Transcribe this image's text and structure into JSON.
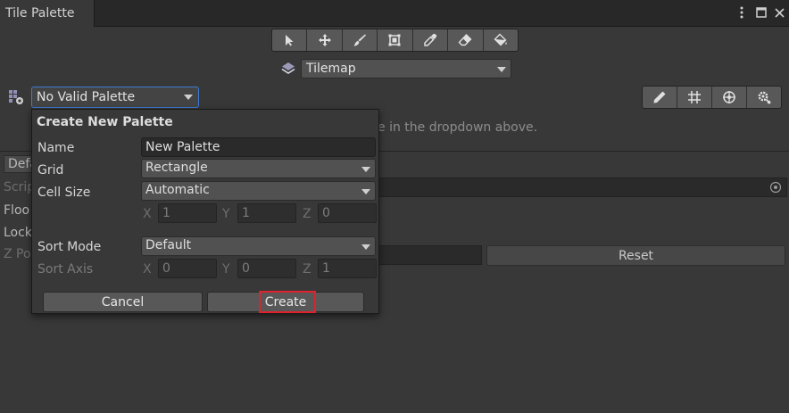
{
  "window": {
    "tab_title": "Tile Palette",
    "menu_icon": "kebab-icon",
    "maximize_icon": "maximize-icon",
    "close_icon": "close-icon"
  },
  "toolbar": {
    "tools": [
      {
        "icon": "select-arrow-icon"
      },
      {
        "icon": "move-icon"
      },
      {
        "icon": "brush-icon"
      },
      {
        "icon": "box-fill-icon"
      },
      {
        "icon": "eyedropper-icon"
      },
      {
        "icon": "eraser-icon"
      },
      {
        "icon": "paint-bucket-icon"
      }
    ]
  },
  "active_tilemap": {
    "value": "Tilemap"
  },
  "palette": {
    "selected": "No Valid Palette"
  },
  "edit_tools": [
    {
      "icon": "pencil-icon"
    },
    {
      "icon": "grid-icon"
    },
    {
      "icon": "gizmo-icon"
    },
    {
      "icon": "settings-gear-icon"
    }
  ],
  "background": {
    "hint_text": "e in the dropdown above.",
    "defaults_tab": "Defa",
    "labels": [
      "Scrip",
      "Floo",
      "Lock",
      "Z Po"
    ],
    "reset_label": "Reset"
  },
  "popup": {
    "title": "Create New Palette",
    "name_label": "Name",
    "name_value": "New Palette",
    "grid_label": "Grid",
    "grid_value": "Rectangle",
    "cell_size_label": "Cell Size",
    "cell_size_value": "Automatic",
    "cell_size_axes": {
      "x": "X",
      "y": "Y",
      "z": "Z"
    },
    "cell_size_xyz": [
      "1",
      "1",
      "0"
    ],
    "sort_mode_label": "Sort Mode",
    "sort_mode_value": "Default",
    "sort_axis_label": "Sort Axis",
    "sort_axis_xyz": [
      "0",
      "0",
      "1"
    ],
    "cancel_label": "Cancel",
    "create_label": "Create"
  },
  "colors": {
    "background": "#383838",
    "titlebar": "#282828",
    "focus_blue": "#3d7ad1",
    "highlight_red": "#e0222c"
  }
}
